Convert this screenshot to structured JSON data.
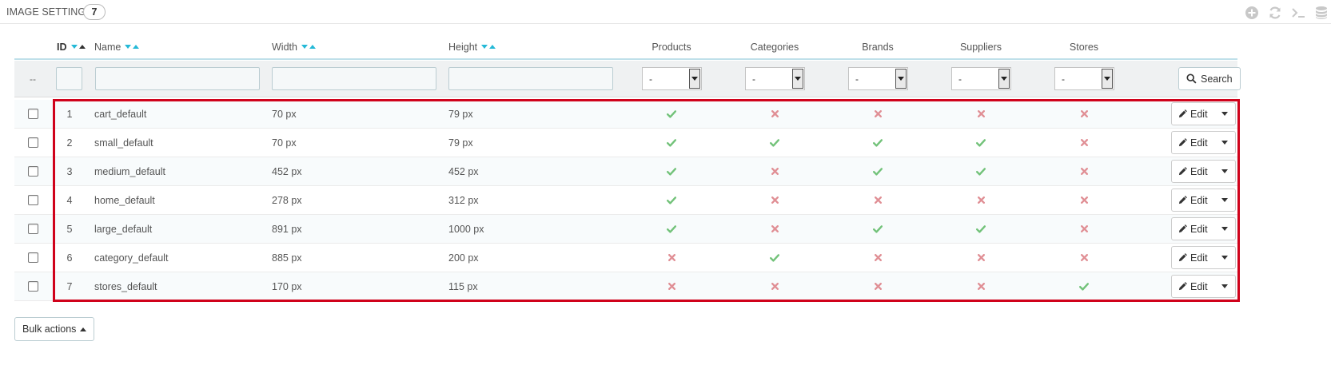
{
  "panel": {
    "title": "IMAGE SETTINGS",
    "count": "7"
  },
  "toolbar": [
    {
      "icon": "plus-circle-icon",
      "name": "add-new-button"
    },
    {
      "icon": "refresh-icon",
      "name": "refresh-list-button"
    },
    {
      "icon": "terminal-icon",
      "name": "show-sql-button"
    },
    {
      "icon": "database-icon",
      "name": "export-sql-button"
    }
  ],
  "columns": {
    "id": "ID",
    "name": "Name",
    "width": "Width",
    "height": "Height",
    "products": "Products",
    "categories": "Categories",
    "brands": "Brands",
    "suppliers": "Suppliers",
    "stores": "Stores"
  },
  "filters": {
    "reset_placeholder": "--",
    "select_value": "-",
    "search_label": "Search"
  },
  "rows": [
    {
      "id": "1",
      "name": "cart_default",
      "width": "70 px",
      "height": "79 px",
      "products": true,
      "categories": false,
      "brands": false,
      "suppliers": false,
      "stores": false
    },
    {
      "id": "2",
      "name": "small_default",
      "width": "70 px",
      "height": "79 px",
      "products": true,
      "categories": true,
      "brands": true,
      "suppliers": true,
      "stores": false
    },
    {
      "id": "3",
      "name": "medium_default",
      "width": "452 px",
      "height": "452 px",
      "products": true,
      "categories": false,
      "brands": true,
      "suppliers": true,
      "stores": false
    },
    {
      "id": "4",
      "name": "home_default",
      "width": "278 px",
      "height": "312 px",
      "products": true,
      "categories": false,
      "brands": false,
      "suppliers": false,
      "stores": false
    },
    {
      "id": "5",
      "name": "large_default",
      "width": "891 px",
      "height": "1000 px",
      "products": true,
      "categories": false,
      "brands": true,
      "suppliers": true,
      "stores": false
    },
    {
      "id": "6",
      "name": "category_default",
      "width": "885 px",
      "height": "200 px",
      "products": false,
      "categories": true,
      "brands": false,
      "suppliers": false,
      "stores": false
    },
    {
      "id": "7",
      "name": "stores_default",
      "width": "170 px",
      "height": "115 px",
      "products": false,
      "categories": false,
      "brands": false,
      "suppliers": false,
      "stores": true
    }
  ],
  "row_action": {
    "edit_label": "Edit"
  },
  "bulk_actions_label": "Bulk actions",
  "colors": {
    "accent": "#25b9d7",
    "yes": "#72c279",
    "no": "#e08f95",
    "highlight_frame": "#d0021b"
  }
}
